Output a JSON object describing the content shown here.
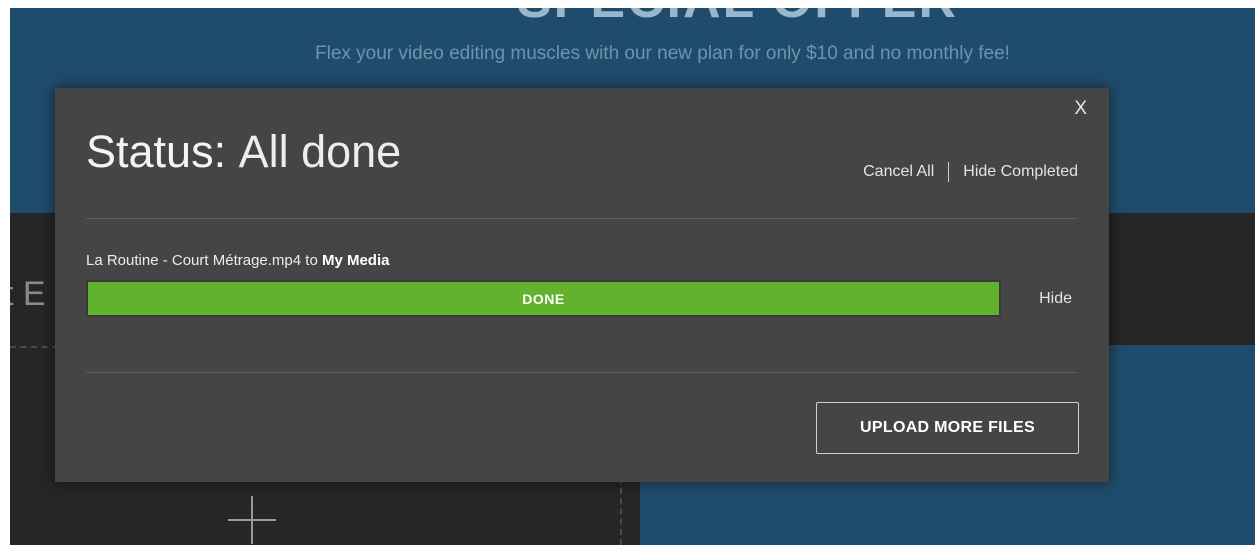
{
  "background": {
    "heading": "SPECIAL OFFER",
    "subtitle": "Flex your video editing muscles with our new plan for only $10 and no monthly fee!",
    "partial_text": "t E",
    "colors": {
      "blue": "#1f4c6c",
      "dark": "#262626"
    }
  },
  "modal": {
    "close_label": "X",
    "status_label": "Status:",
    "status_value": "All done",
    "cancel_all_label": "Cancel All",
    "hide_completed_label": "Hide Completed",
    "uploads": [
      {
        "file_name": "La Routine - Court Métrage.mp4",
        "to_text": "to",
        "destination": "My Media",
        "progress_label": "DONE",
        "progress_fraction": 1.0,
        "hide_label": "Hide"
      }
    ],
    "upload_more_label": "UPLOAD MORE FILES",
    "colors": {
      "panel": "#454545",
      "progress": "#62b22f"
    }
  },
  "icons": {
    "close": "close-icon",
    "add": "plus-icon"
  }
}
